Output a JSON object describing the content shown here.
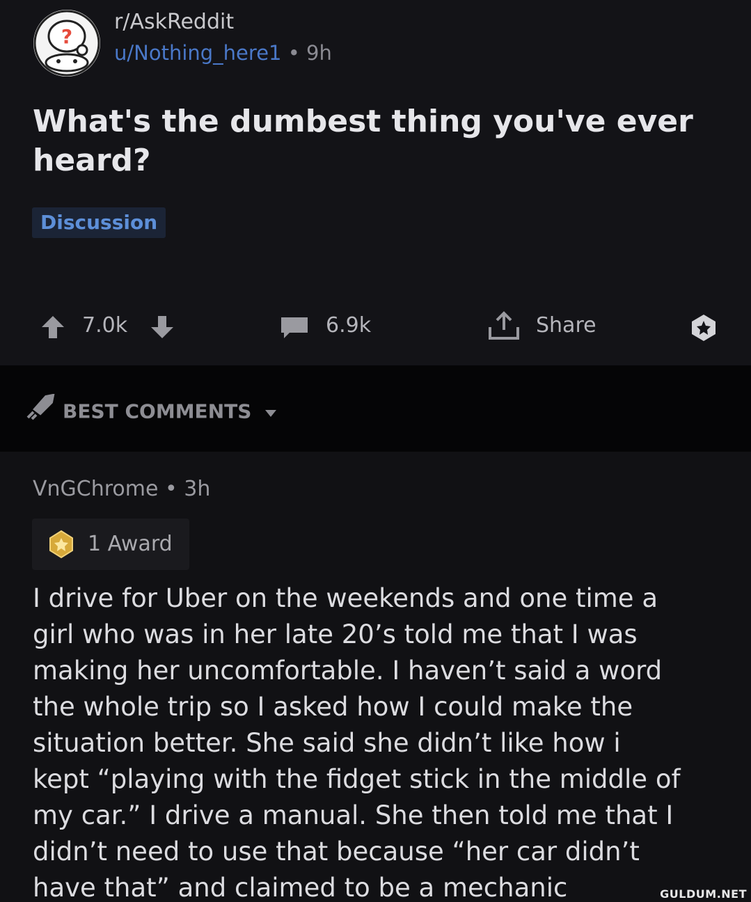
{
  "post": {
    "subreddit": "r/AskReddit",
    "author": "u/Nothing_here1",
    "separator": " • ",
    "age": "9h",
    "title": "What's the dumbest thing you've ever heard?",
    "flair": "Discussion",
    "votes": "7.0k",
    "comments": "6.9k",
    "share_label": "Share"
  },
  "sort": {
    "label": "BEST COMMENTS"
  },
  "comment": {
    "author": "VnGChrome",
    "separator": " • ",
    "age": "3h",
    "award_label": "1 Award",
    "lines": [
      "I drive for Uber on the weekends and one time a",
      "girl who was in her late 20’s told me that I was",
      "making her uncomfortable. I haven’t said a word",
      "the whole trip so I asked how I could make the",
      "situation better. She said she didn’t like how i",
      "kept “playing with the fidget stick in the middle of",
      "my car.” I drive a manual. She then told me that I",
      "didn’t need to use that because “her car didn’t",
      "have that” and claimed to be a mechanic"
    ]
  },
  "watermark": "GULDUM.NET",
  "colors": {
    "background": "#131317",
    "user_link": "#4a78c8",
    "flair_text": "#5d8fd8",
    "flair_bg": "#1b2436"
  },
  "icons": {
    "avatar": "snoo-question-avatar",
    "upvote": "arrow-up-icon",
    "downvote": "arrow-down-icon",
    "comments": "comment-bubble-icon",
    "share": "share-icon",
    "award_badge": "award-badge-icon",
    "sort": "rocket-icon",
    "award": "gold-award-icon"
  }
}
